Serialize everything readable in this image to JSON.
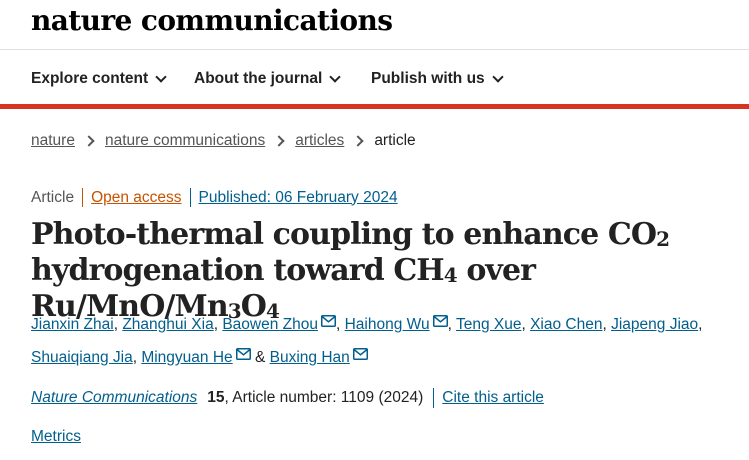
{
  "site": {
    "logo": "nature communications"
  },
  "nav": {
    "items": [
      {
        "label": "Explore content"
      },
      {
        "label": "About the journal"
      },
      {
        "label": "Publish with us"
      }
    ]
  },
  "colors": {
    "accent_red": "#d6341e",
    "link_blue": "#025e8d",
    "open_access_orange": "#c65301",
    "text": "#222222"
  },
  "breadcrumb": {
    "items": [
      "nature",
      "nature communications",
      "articles"
    ],
    "current": "article"
  },
  "article_meta": {
    "type": "Article",
    "open_access": "Open access",
    "published": "Published: 06 February 2024"
  },
  "title": {
    "line1_a": "Photo-thermal coupling to enhance CO",
    "line1_sub": "2",
    "line2_a": "hydrogenation toward CH",
    "line2_sub1": "4",
    "line2_b": " over Ru/MnO/Mn",
    "line2_sub2": "3",
    "line2_c": "O",
    "line2_sub3": "4"
  },
  "authors": {
    "list": [
      "Jianxin Zhai",
      "Zhanghui Xia",
      "Baowen Zhou",
      "Haihong Wu",
      "Teng Xue",
      "Xiao Chen",
      "Jiapeng Jiao",
      "Shuaiqiang Jia",
      "Mingyuan He",
      "Buxing Han"
    ],
    "and": "&",
    "comma": ","
  },
  "citation": {
    "journal": "Nature Communications",
    "volume": "15",
    "details": ", Article number: 1109 (2024)",
    "cite_link": "Cite this article"
  },
  "metrics": {
    "label": "Metrics"
  }
}
